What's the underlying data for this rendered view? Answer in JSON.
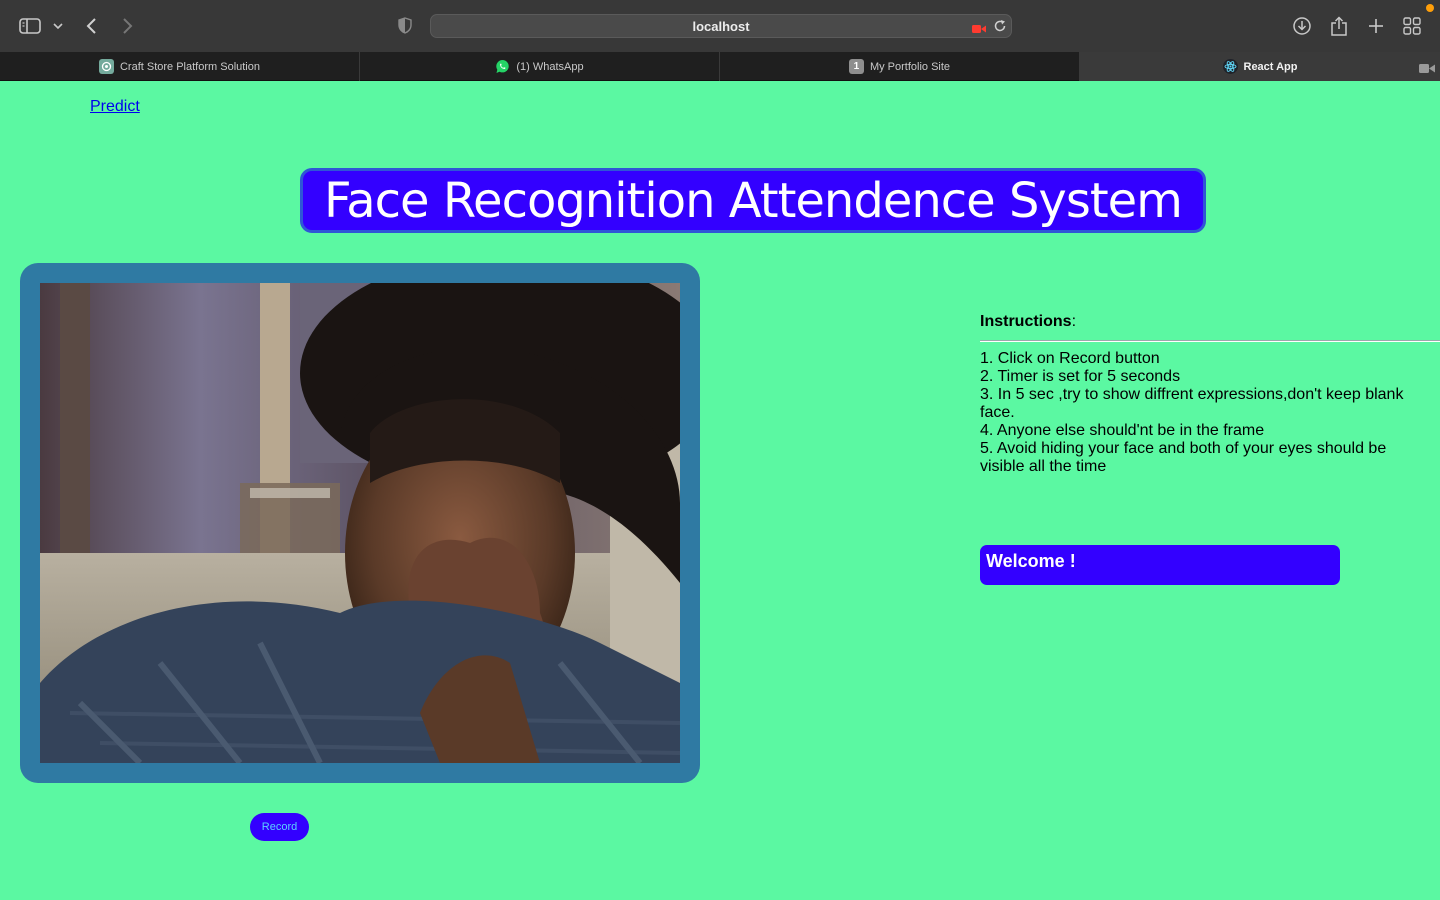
{
  "browser": {
    "url": "localhost",
    "tabs": [
      {
        "label": "Craft Store Platform Solution",
        "icon": "openai-icon",
        "active": false
      },
      {
        "label": "(1) WhatsApp",
        "icon": "whatsapp-icon",
        "active": false
      },
      {
        "label": "My Portfolio Site",
        "icon": "number-one-icon",
        "badge": "1",
        "active": false
      },
      {
        "label": "React App",
        "icon": "react-icon",
        "active": true
      }
    ]
  },
  "page": {
    "nav_link": "Predict",
    "title": "Face Recognition Attendence System",
    "record_label": "Record",
    "instructions": {
      "heading": "Instructions",
      "heading_suffix": ":",
      "items": [
        "1. Click on Record button",
        "2. Timer is set for 5 seconds",
        "3. In 5 sec ,try to show diffrent expressions,don't keep blank face.",
        "4. Anyone else should'nt be in the frame",
        "5. Avoid hiding your face and both of your eyes should be visible all the time"
      ]
    },
    "welcome": "Welcome !"
  },
  "colors": {
    "page_bg": "#5bf8a2",
    "accent": "#3300ff",
    "webcam_border": "#2f7aa3",
    "link": "#0000ee"
  }
}
